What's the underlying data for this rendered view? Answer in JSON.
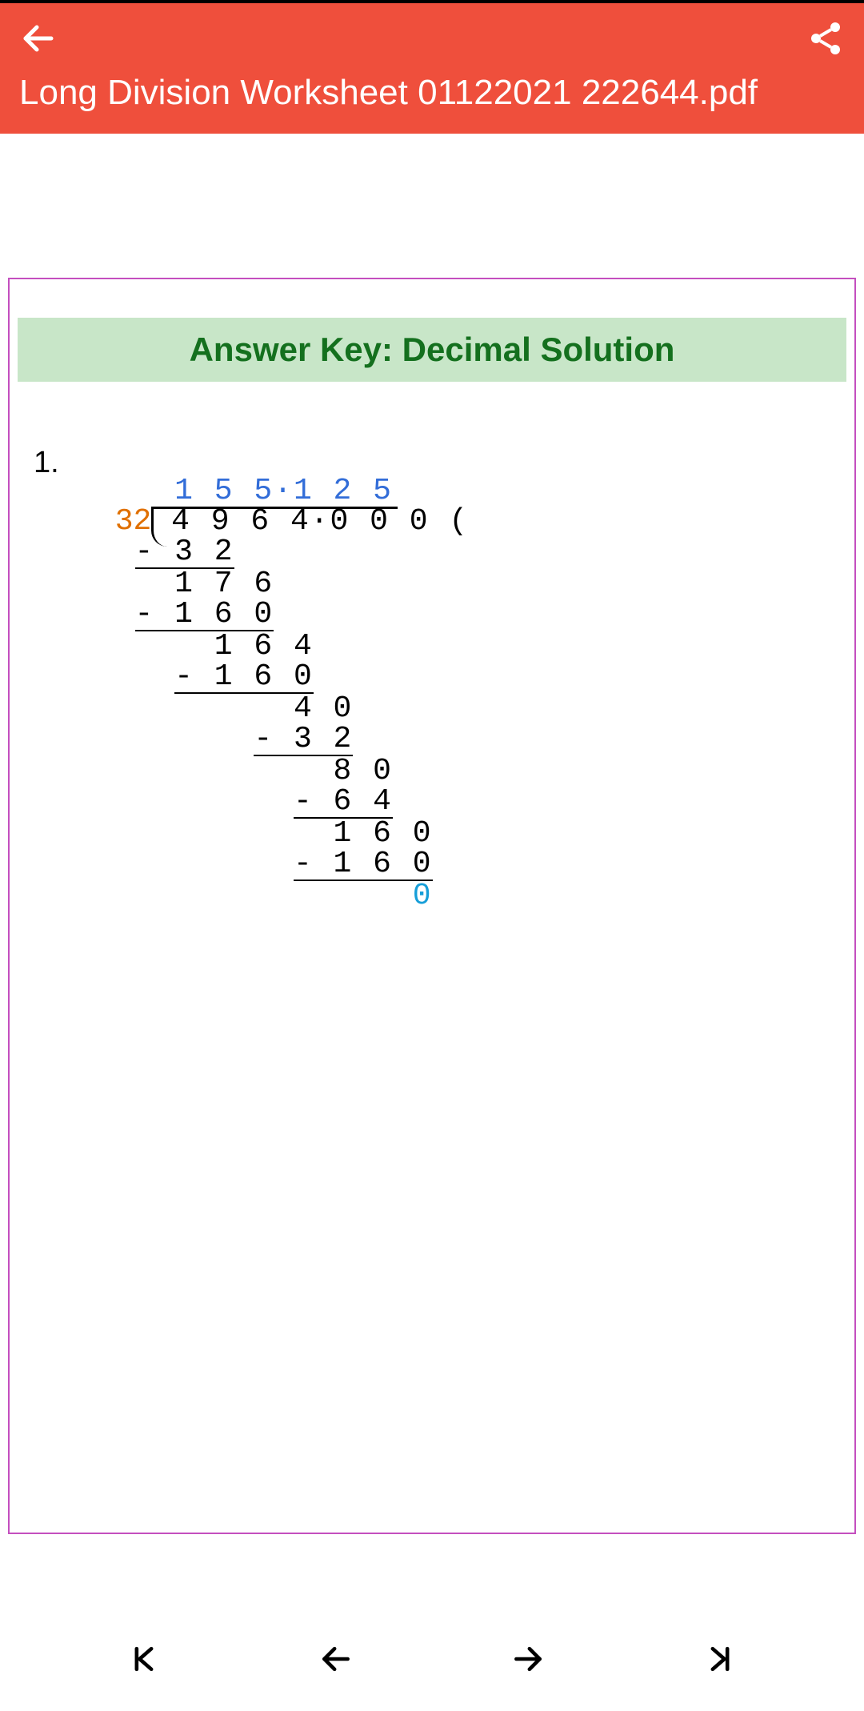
{
  "header": {
    "title": "Long Division Worksheet 01122021 222644.pdf"
  },
  "banner": {
    "text": "Answer Key: Decimal Solution"
  },
  "problem": {
    "number": "1.",
    "quotient": "1 5 5·1 2 5",
    "divisor": "32",
    "dividend": "4 9 6 4·0 0 0",
    "paren": "(",
    "steps": {
      "s1": "- 3 2",
      "s2": "1 7 6",
      "s3": "- 1 6 0",
      "s4": "1 6 4",
      "s5": "- 1 6 0",
      "s6": "4 0",
      "s7": "- 3 2",
      "s8": "8 0",
      "s9": "- 6 4",
      "s10": "1 6 0",
      "s11": "- 1 6 0",
      "s12": "0"
    }
  }
}
